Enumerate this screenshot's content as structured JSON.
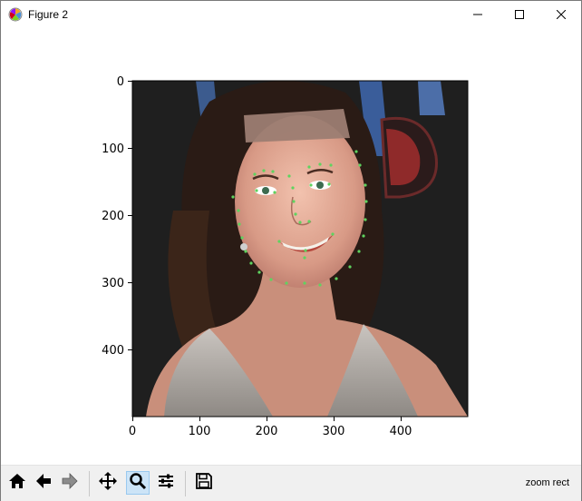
{
  "window": {
    "title": "Figure 2",
    "app_icon": "matplotlib-icon",
    "controls": [
      "minimize-icon",
      "maximize-icon",
      "close-icon"
    ]
  },
  "plot": {
    "image": "photo of a smiling woman with long dark hair with green facial landmark points overlaid",
    "x_ticks": [
      "0",
      "100",
      "200",
      "300",
      "400"
    ],
    "y_ticks": [
      "0",
      "100",
      "200",
      "300",
      "400"
    ],
    "x_range": [
      0,
      500
    ],
    "y_range": [
      0,
      500
    ],
    "y_inverted": true
  },
  "toolbar": {
    "buttons": [
      {
        "name": "home-button",
        "icon": "home-icon"
      },
      {
        "name": "back-button",
        "icon": "arrow-left-icon"
      },
      {
        "name": "forward-button",
        "icon": "arrow-right-icon"
      },
      {
        "name": "pan-button",
        "icon": "move-icon"
      },
      {
        "name": "zoom-button",
        "icon": "magnifier-icon",
        "active": true
      },
      {
        "name": "configure-subplots-button",
        "icon": "sliders-icon"
      },
      {
        "name": "save-button",
        "icon": "floppy-disk-icon"
      }
    ],
    "status": "zoom rect"
  },
  "colors": {
    "landmarks": "#5fd35f",
    "active_button": "#cce4f7",
    "toolbar_bg": "#f0f0f0"
  }
}
